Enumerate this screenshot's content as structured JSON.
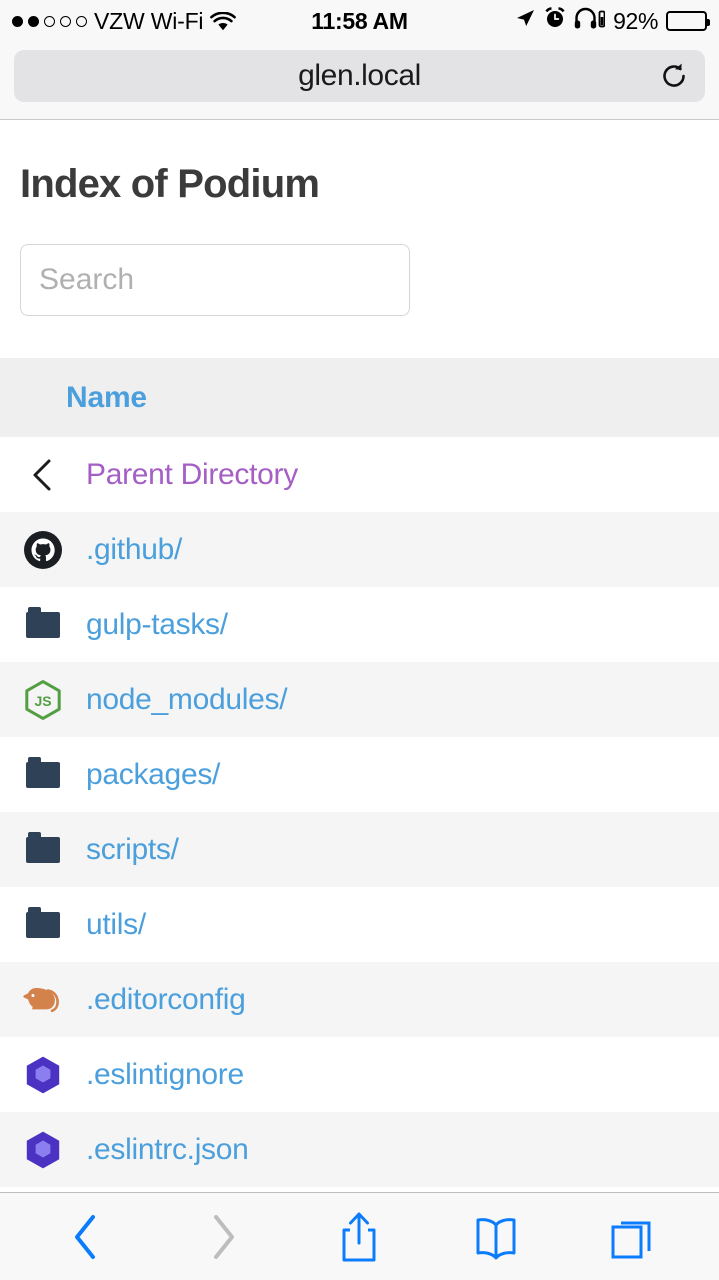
{
  "status_bar": {
    "signal_dots_filled": 2,
    "signal_dots_total": 5,
    "carrier": "VZW Wi-Fi",
    "wifi_icon": "wifi-icon",
    "time": "11:58 AM",
    "location_icon": "location-arrow-icon",
    "alarm_icon": "alarm-clock-icon",
    "headphones_icon": "headphones-icon",
    "battery_percent": "92%",
    "battery_level": 92
  },
  "browser": {
    "url": "glen.local",
    "reload_icon": "reload-icon"
  },
  "page": {
    "title": "Index of Podium",
    "search": {
      "placeholder": "Search",
      "value": ""
    },
    "table": {
      "columns": [
        "Name"
      ],
      "rows": [
        {
          "label": "Parent Directory",
          "icon": "chevron-left-icon",
          "visited": true
        },
        {
          "label": ".github/",
          "icon": "github-icon",
          "visited": false
        },
        {
          "label": "gulp-tasks/",
          "icon": "folder-icon",
          "visited": false
        },
        {
          "label": "node_modules/",
          "icon": "nodejs-icon",
          "visited": false
        },
        {
          "label": "packages/",
          "icon": "folder-icon",
          "visited": false
        },
        {
          "label": "scripts/",
          "icon": "folder-icon",
          "visited": false
        },
        {
          "label": "utils/",
          "icon": "folder-icon",
          "visited": false
        },
        {
          "label": ".editorconfig",
          "icon": "editorconfig-icon",
          "visited": false
        },
        {
          "label": ".eslintignore",
          "icon": "eslint-icon",
          "visited": false
        },
        {
          "label": ".eslintrc.json",
          "icon": "eslint-icon",
          "visited": false
        }
      ]
    }
  },
  "toolbar": {
    "back_icon": "back-chevron-icon",
    "forward_icon": "forward-chevron-icon",
    "share_icon": "share-icon",
    "bookmarks_icon": "bookmarks-book-icon",
    "tabs_icon": "tabs-icon"
  },
  "colors": {
    "link": "#4a9fdc",
    "visited_link": "#a55fc4",
    "folder": "#2f4156",
    "node_green": "#539e43",
    "eslint_purple": "#4b32c3",
    "editorconfig_orange": "#d2824a",
    "toolbar_blue": "#0b7cfb",
    "header_bg": "#efefef",
    "row_alt_bg": "#f5f5f5"
  }
}
